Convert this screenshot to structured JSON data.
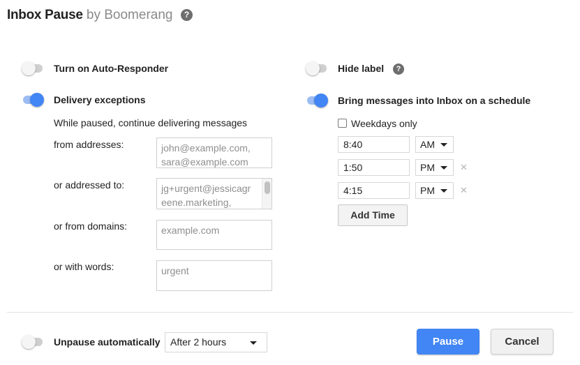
{
  "header": {
    "brand": "Inbox Pause",
    "by": "by Boomerang"
  },
  "auto_responder": {
    "label": "Turn on Auto-Responder",
    "enabled": false
  },
  "hide_label": {
    "label": "Hide label",
    "enabled": false
  },
  "delivery_exceptions": {
    "label": "Delivery exceptions",
    "enabled": true,
    "description": "While paused, continue delivering messages",
    "from_addresses": {
      "label": "from addresses:",
      "line1": "john@example.com,",
      "line2": "sara@example.com"
    },
    "addressed_to": {
      "label": "or addressed to:",
      "line1": "jg+urgent@jessicagr",
      "line2": "eene.marketing,"
    },
    "from_domains": {
      "label": "or from domains:",
      "placeholder": "example.com"
    },
    "with_words": {
      "label": "or with words:",
      "placeholder": "urgent"
    }
  },
  "schedule": {
    "label": "Bring messages into Inbox on a schedule",
    "enabled": true,
    "weekdays_label": "Weekdays only",
    "weekdays_checked": false,
    "times": [
      {
        "time": "8:40",
        "period": "AM"
      },
      {
        "time": "1:50",
        "period": "PM",
        "remove": "✕"
      },
      {
        "time": "4:15",
        "period": "PM",
        "remove": "✕"
      }
    ],
    "add_time_label": "Add Time"
  },
  "footer": {
    "unpause_label": "Unpause automatically",
    "unpause_enabled": false,
    "unpause_value": "After 2 hours",
    "pause_label": "Pause",
    "cancel_label": "Cancel"
  },
  "icons": {
    "help": "?",
    "remove": "✕"
  },
  "colors": {
    "accent": "#4285f4",
    "toggle_on_track": "#9cbcf3",
    "toggle_off_track": "#cfcfcf"
  }
}
